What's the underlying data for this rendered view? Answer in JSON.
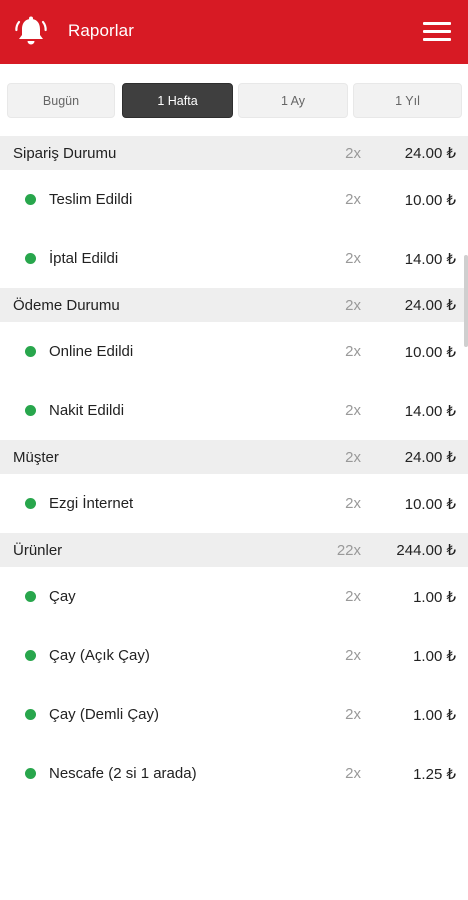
{
  "header": {
    "title": "Raporlar",
    "bell_icon": "bell-icon",
    "menu_icon": "hamburger-menu-icon",
    "color": "#d71a24"
  },
  "tabs": [
    {
      "label": "Bugün",
      "active": false
    },
    {
      "label": "1 Hafta",
      "active": true
    },
    {
      "label": "1 Ay",
      "active": false
    },
    {
      "label": "1 Yıl",
      "active": false
    }
  ],
  "report": [
    {
      "type": "section",
      "label": "Sipariş Durumu",
      "count": "2x",
      "amount": "24.00 ₺"
    },
    {
      "type": "item",
      "label": "Teslim Edildi",
      "count": "2x",
      "amount": "10.00 ₺"
    },
    {
      "type": "item",
      "label": "İptal Edildi",
      "count": "2x",
      "amount": "14.00 ₺"
    },
    {
      "type": "section",
      "label": "Ödeme Durumu",
      "count": "2x",
      "amount": "24.00 ₺"
    },
    {
      "type": "item",
      "label": "Online Edildi",
      "count": "2x",
      "amount": "10.00 ₺"
    },
    {
      "type": "item",
      "label": "Nakit Edildi",
      "count": "2x",
      "amount": "14.00 ₺"
    },
    {
      "type": "section",
      "label": "Müşter",
      "count": "2x",
      "amount": "24.00 ₺"
    },
    {
      "type": "item",
      "label": "Ezgi İnternet",
      "count": "2x",
      "amount": "10.00 ₺"
    },
    {
      "type": "section",
      "label": "Ürünler",
      "count": "22x",
      "amount": "244.00 ₺"
    },
    {
      "type": "item",
      "label": "Çay",
      "count": "2x",
      "amount": "1.00 ₺"
    },
    {
      "type": "item",
      "label": "Çay (Açık Çay)",
      "count": "2x",
      "amount": "1.00 ₺"
    },
    {
      "type": "item",
      "label": "Çay (Demli Çay)",
      "count": "2x",
      "amount": "1.00 ₺"
    },
    {
      "type": "item",
      "label": "Nescafe (2 si 1 arada)",
      "count": "2x",
      "amount": "1.25 ₺"
    }
  ],
  "colors": {
    "accent": "#d71a24",
    "active_tab": "#3f3f3f",
    "status_dot": "#28a64c",
    "section_bg": "#eeeeee"
  }
}
